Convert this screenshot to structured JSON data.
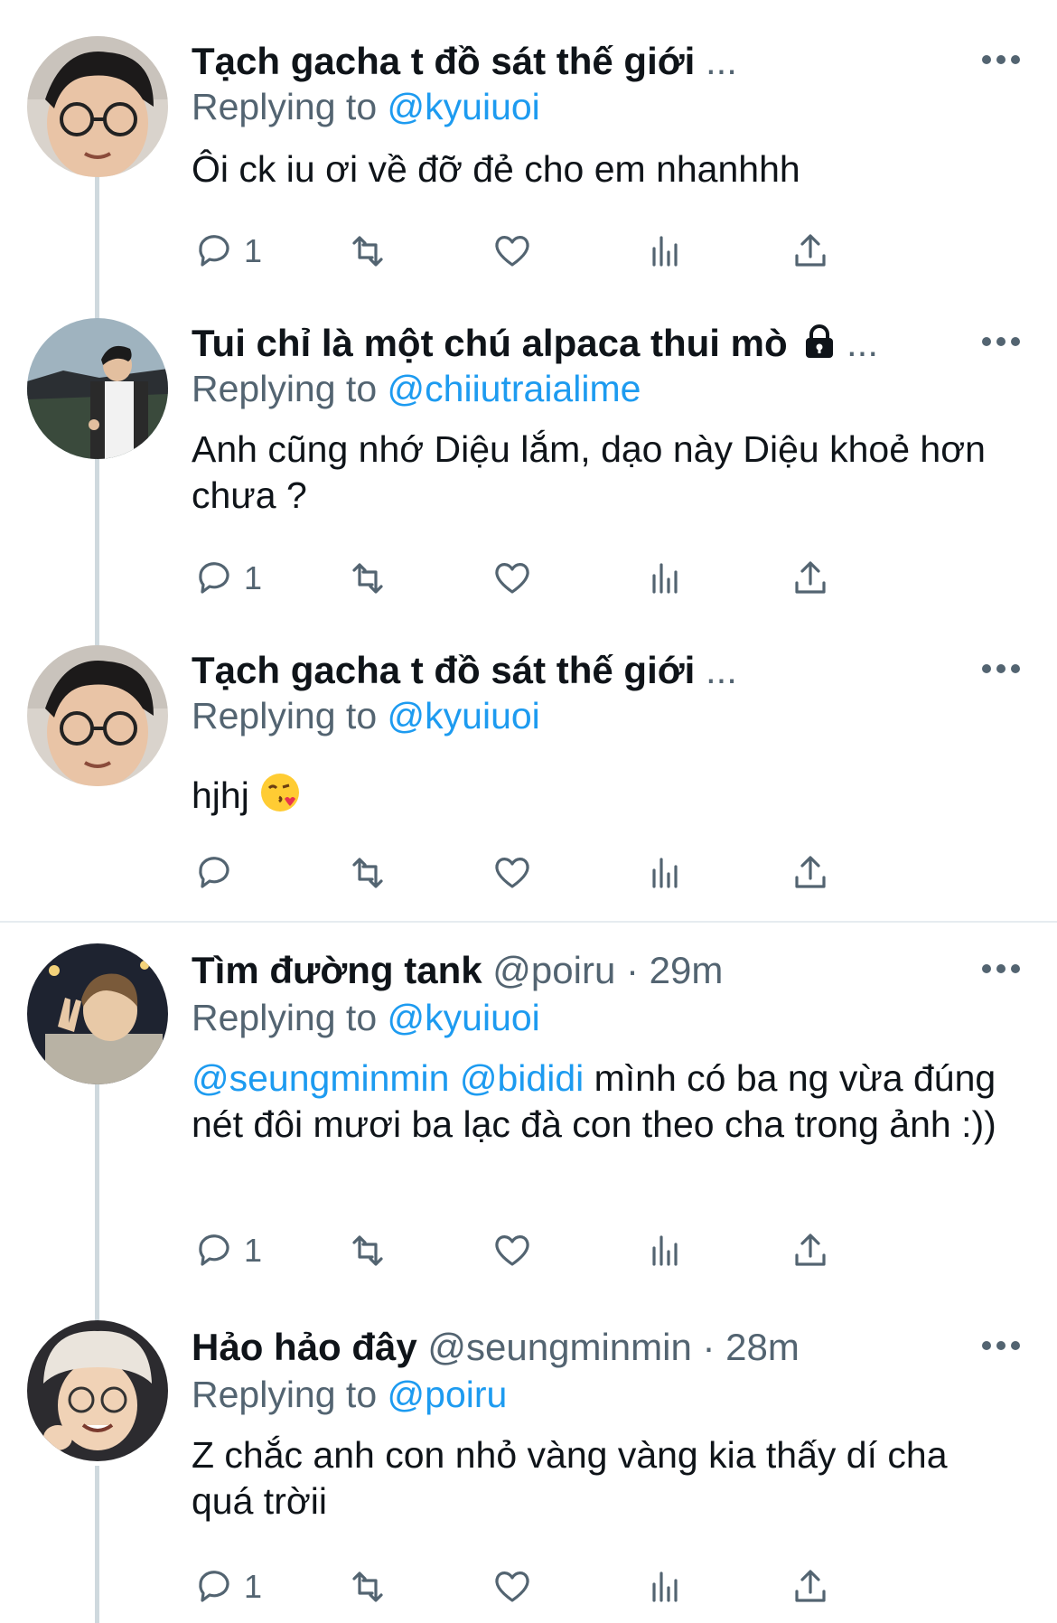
{
  "tweets": [
    {
      "name": "Tạch gacha t đồ sát thế giới",
      "truncation": "...",
      "handle": "",
      "time": "",
      "replying_prefix": "Replying to",
      "replying_to": "@kyuiuoi",
      "body": "Ôi ck iu ơi về đỡ đẻ cho em nhanhhh",
      "reply_count": "1",
      "avatar_icon": "profile-photo-glasses"
    },
    {
      "name": "Tui chỉ là một chú alpaca thui mò",
      "truncation": "...",
      "locked": true,
      "replying_prefix": "Replying to",
      "replying_to": "@chiiutraialime",
      "body": "Anh cũng nhớ Diệu lắm, dạo này Diệu khoẻ hơn chưa ?",
      "reply_count": "1",
      "avatar_icon": "profile-photo-outdoor"
    },
    {
      "name": "Tạch gacha t đồ sát thế giới",
      "truncation": "...",
      "replying_prefix": "Replying to",
      "replying_to": "@kyuiuoi",
      "body": "hjhj",
      "body_emoji": "face-blowing-kiss-emoji",
      "reply_count": "",
      "avatar_icon": "profile-photo-glasses"
    },
    {
      "name": "Tìm đường tank",
      "handle": "@poiru",
      "sep": "·",
      "time": "29m",
      "replying_prefix": "Replying to",
      "replying_to": "@kyuiuoi",
      "body_mentions": [
        "@seungminmin",
        "@bididi"
      ],
      "body": "mình có ba ng vừa đúng nét đôi mươi ba lạc đà con theo cha trong ảnh :))",
      "reply_count": "1",
      "avatar_icon": "profile-photo-peace-sign"
    },
    {
      "name": "Hảo hảo đây",
      "handle": "@seungminmin",
      "sep": "·",
      "time": "28m",
      "replying_prefix": "Replying to",
      "replying_to": "@poiru",
      "body": "Z chắc anh con nhỏ vàng vàng kia thấy dí cha quá trờii",
      "reply_count": "1",
      "avatar_icon": "profile-photo-bucket-hat"
    }
  ],
  "colors": {
    "accent": "#1d9bf0",
    "muted": "#536471",
    "text": "#0f1419",
    "thread": "#cfd9de"
  }
}
